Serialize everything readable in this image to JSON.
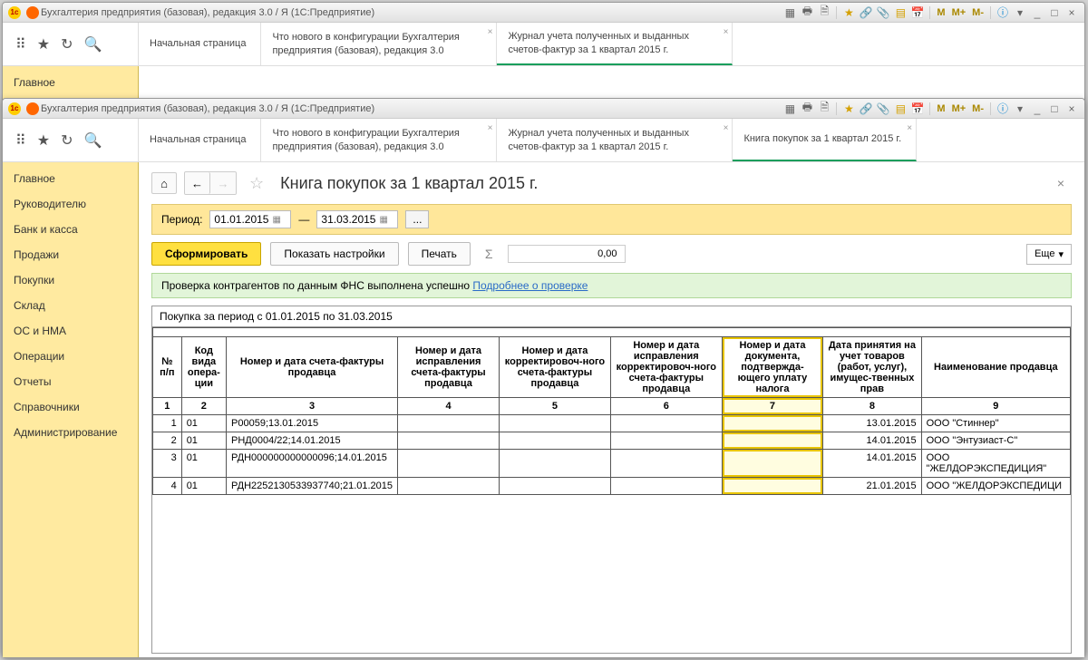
{
  "window1": {
    "title": "Бухгалтерия предприятия (базовая), редакция 3.0 / Я   (1С:Предприятие)",
    "tabs": [
      "Начальная страница",
      "Что нового в конфигурации Бухгалтерия предприятия (базовая), редакция 3.0",
      "Журнал учета полученных и выданных счетов-фактур за 1 квартал 2015 г."
    ],
    "sidebar_items": [
      "Главное"
    ]
  },
  "window2": {
    "title": "Бухгалтерия предприятия (базовая), редакция 3.0 / Я   (1С:Предприятие)",
    "tabs": [
      "Начальная страница",
      "Что нового в конфигурации Бухгалтерия предприятия (базовая), редакция 3.0",
      "Журнал учета полученных и выданных счетов-фактур за 1 квартал 2015 г.",
      "Книга покупок за 1 квартал 2015 г."
    ],
    "active_tab": 3,
    "sidebar_items": [
      "Главное",
      "Руководителю",
      "Банк и касса",
      "Продажи",
      "Покупки",
      "Склад",
      "ОС и НМА",
      "Операции",
      "Отчеты",
      "Справочники",
      "Администрирование"
    ],
    "page_title": "Книга покупок за 1 квартал 2015 г.",
    "period_label": "Период:",
    "date_from": "01.01.2015",
    "date_sep": "—",
    "date_to": "31.03.2015",
    "btn_form": "Сформировать",
    "btn_settings": "Показать настройки",
    "btn_print": "Печать",
    "sum_value": "0,00",
    "btn_more": "Еще",
    "info_text": "Проверка контрагентов по данным ФНС выполнена успешно ",
    "info_link": "Подробнее о проверке",
    "report_period": "Покупка за период с 01.01.2015 по 31.03.2015",
    "columns": [
      "№ п/п",
      "Код вида опера-ции",
      "Номер и дата счета-фактуры продавца",
      "Номер и дата исправления счета-фактуры продавца",
      "Номер и дата корректировоч-ного счета-фактуры продавца",
      "Номер и дата исправления корректировоч-ного счета-фактуры продавца",
      "Номер и дата документа, подтвержда-ющего уплату налога",
      "Дата принятия на учет товаров (работ, услуг), имущес-твенных прав",
      "Наименование продавца"
    ],
    "col_nums": [
      "1",
      "2",
      "3",
      "4",
      "5",
      "6",
      "7",
      "8",
      "9"
    ],
    "rows": [
      {
        "n": "1",
        "code": "01",
        "doc": "Р00059;13.01.2015",
        "c4": "",
        "c5": "",
        "c6": "",
        "c7": "",
        "date": "13.01.2015",
        "seller": "ООО \"Стиннер\""
      },
      {
        "n": "2",
        "code": "01",
        "doc": "РНД0004/22;14.01.2015",
        "c4": "",
        "c5": "",
        "c6": "",
        "c7": "",
        "date": "14.01.2015",
        "seller": "ООО \"Энтузиаст-С\""
      },
      {
        "n": "3",
        "code": "01",
        "doc": "РДН000000000000096;14.01.2015",
        "c4": "",
        "c5": "",
        "c6": "",
        "c7": "",
        "date": "14.01.2015",
        "seller": "ООО \"ЖЕЛДОРЭКСПЕДИЦИЯ\""
      },
      {
        "n": "4",
        "code": "01",
        "doc": "РДН2252130533937740;21.01.2015",
        "c4": "",
        "c5": "",
        "c6": "",
        "c7": "",
        "date": "21.01.2015",
        "seller": "ООО \"ЖЕЛДОРЭКСПЕДИЦИ"
      }
    ],
    "titlebar_m": [
      "M",
      "M+",
      "M-"
    ]
  }
}
